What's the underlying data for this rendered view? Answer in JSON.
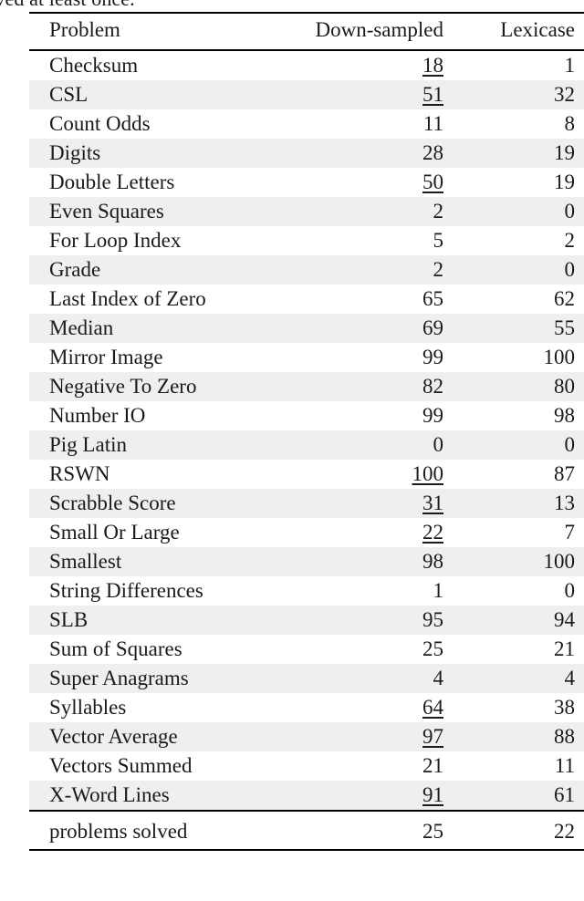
{
  "caption": {
    "partial_line": "each method solved at least once."
  },
  "table": {
    "columns": [
      "Problem",
      "Down-sampled",
      "Lexicase"
    ],
    "rows": [
      {
        "problem": "Checksum",
        "down_sampled": "18",
        "lexicase": "1",
        "best": "down_sampled"
      },
      {
        "problem": "CSL",
        "down_sampled": "51",
        "lexicase": "32",
        "best": "down_sampled"
      },
      {
        "problem": "Count Odds",
        "down_sampled": "11",
        "lexicase": "8",
        "best": ""
      },
      {
        "problem": "Digits",
        "down_sampled": "28",
        "lexicase": "19",
        "best": ""
      },
      {
        "problem": "Double Letters",
        "down_sampled": "50",
        "lexicase": "19",
        "best": "down_sampled"
      },
      {
        "problem": "Even Squares",
        "down_sampled": "2",
        "lexicase": "0",
        "best": ""
      },
      {
        "problem": "For Loop Index",
        "down_sampled": "5",
        "lexicase": "2",
        "best": ""
      },
      {
        "problem": "Grade",
        "down_sampled": "2",
        "lexicase": "0",
        "best": ""
      },
      {
        "problem": "Last Index of Zero",
        "down_sampled": "65",
        "lexicase": "62",
        "best": ""
      },
      {
        "problem": "Median",
        "down_sampled": "69",
        "lexicase": "55",
        "best": ""
      },
      {
        "problem": "Mirror Image",
        "down_sampled": "99",
        "lexicase": "100",
        "best": ""
      },
      {
        "problem": "Negative To Zero",
        "down_sampled": "82",
        "lexicase": "80",
        "best": ""
      },
      {
        "problem": "Number IO",
        "down_sampled": "99",
        "lexicase": "98",
        "best": ""
      },
      {
        "problem": "Pig Latin",
        "down_sampled": "0",
        "lexicase": "0",
        "best": ""
      },
      {
        "problem": "RSWN",
        "down_sampled": "100",
        "lexicase": "87",
        "best": "down_sampled"
      },
      {
        "problem": "Scrabble Score",
        "down_sampled": "31",
        "lexicase": "13",
        "best": "down_sampled"
      },
      {
        "problem": "Small Or Large",
        "down_sampled": "22",
        "lexicase": "7",
        "best": "down_sampled"
      },
      {
        "problem": "Smallest",
        "down_sampled": "98",
        "lexicase": "100",
        "best": ""
      },
      {
        "problem": "String Differences",
        "down_sampled": "1",
        "lexicase": "0",
        "best": ""
      },
      {
        "problem": "SLB",
        "down_sampled": "95",
        "lexicase": "94",
        "best": ""
      },
      {
        "problem": "Sum of Squares",
        "down_sampled": "25",
        "lexicase": "21",
        "best": ""
      },
      {
        "problem": "Super Anagrams",
        "down_sampled": "4",
        "lexicase": "4",
        "best": ""
      },
      {
        "problem": "Syllables",
        "down_sampled": "64",
        "lexicase": "38",
        "best": "down_sampled"
      },
      {
        "problem": "Vector Average",
        "down_sampled": "97",
        "lexicase": "88",
        "best": "down_sampled"
      },
      {
        "problem": "Vectors Summed",
        "down_sampled": "21",
        "lexicase": "11",
        "best": ""
      },
      {
        "problem": "X-Word Lines",
        "down_sampled": "91",
        "lexicase": "61",
        "best": "down_sampled"
      }
    ],
    "summary": {
      "label": "problems solved",
      "down_sampled": "25",
      "lexicase": "22"
    }
  },
  "style": {
    "stripe_color": "#efefef",
    "rule_color": "#000000",
    "text_color": "#1a1a1a"
  }
}
